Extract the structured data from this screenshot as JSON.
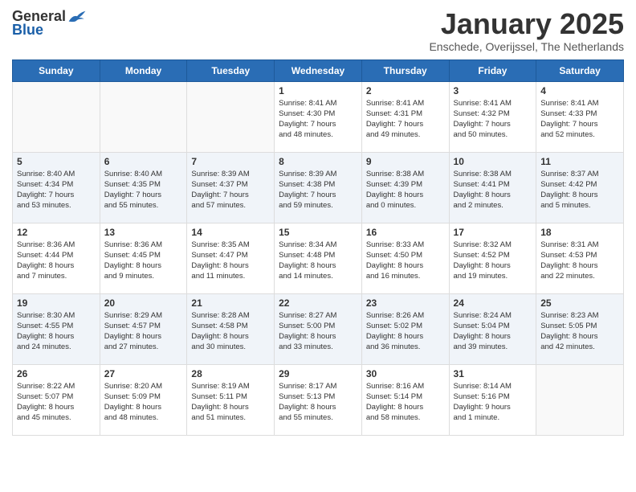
{
  "logo": {
    "general": "General",
    "blue": "Blue"
  },
  "title": "January 2025",
  "location": "Enschede, Overijssel, The Netherlands",
  "days_header": [
    "Sunday",
    "Monday",
    "Tuesday",
    "Wednesday",
    "Thursday",
    "Friday",
    "Saturday"
  ],
  "weeks": [
    {
      "shaded": false,
      "days": [
        {
          "num": "",
          "info": ""
        },
        {
          "num": "",
          "info": ""
        },
        {
          "num": "",
          "info": ""
        },
        {
          "num": "1",
          "info": "Sunrise: 8:41 AM\nSunset: 4:30 PM\nDaylight: 7 hours\nand 48 minutes."
        },
        {
          "num": "2",
          "info": "Sunrise: 8:41 AM\nSunset: 4:31 PM\nDaylight: 7 hours\nand 49 minutes."
        },
        {
          "num": "3",
          "info": "Sunrise: 8:41 AM\nSunset: 4:32 PM\nDaylight: 7 hours\nand 50 minutes."
        },
        {
          "num": "4",
          "info": "Sunrise: 8:41 AM\nSunset: 4:33 PM\nDaylight: 7 hours\nand 52 minutes."
        }
      ]
    },
    {
      "shaded": true,
      "days": [
        {
          "num": "5",
          "info": "Sunrise: 8:40 AM\nSunset: 4:34 PM\nDaylight: 7 hours\nand 53 minutes."
        },
        {
          "num": "6",
          "info": "Sunrise: 8:40 AM\nSunset: 4:35 PM\nDaylight: 7 hours\nand 55 minutes."
        },
        {
          "num": "7",
          "info": "Sunrise: 8:39 AM\nSunset: 4:37 PM\nDaylight: 7 hours\nand 57 minutes."
        },
        {
          "num": "8",
          "info": "Sunrise: 8:39 AM\nSunset: 4:38 PM\nDaylight: 7 hours\nand 59 minutes."
        },
        {
          "num": "9",
          "info": "Sunrise: 8:38 AM\nSunset: 4:39 PM\nDaylight: 8 hours\nand 0 minutes."
        },
        {
          "num": "10",
          "info": "Sunrise: 8:38 AM\nSunset: 4:41 PM\nDaylight: 8 hours\nand 2 minutes."
        },
        {
          "num": "11",
          "info": "Sunrise: 8:37 AM\nSunset: 4:42 PM\nDaylight: 8 hours\nand 5 minutes."
        }
      ]
    },
    {
      "shaded": false,
      "days": [
        {
          "num": "12",
          "info": "Sunrise: 8:36 AM\nSunset: 4:44 PM\nDaylight: 8 hours\nand 7 minutes."
        },
        {
          "num": "13",
          "info": "Sunrise: 8:36 AM\nSunset: 4:45 PM\nDaylight: 8 hours\nand 9 minutes."
        },
        {
          "num": "14",
          "info": "Sunrise: 8:35 AM\nSunset: 4:47 PM\nDaylight: 8 hours\nand 11 minutes."
        },
        {
          "num": "15",
          "info": "Sunrise: 8:34 AM\nSunset: 4:48 PM\nDaylight: 8 hours\nand 14 minutes."
        },
        {
          "num": "16",
          "info": "Sunrise: 8:33 AM\nSunset: 4:50 PM\nDaylight: 8 hours\nand 16 minutes."
        },
        {
          "num": "17",
          "info": "Sunrise: 8:32 AM\nSunset: 4:52 PM\nDaylight: 8 hours\nand 19 minutes."
        },
        {
          "num": "18",
          "info": "Sunrise: 8:31 AM\nSunset: 4:53 PM\nDaylight: 8 hours\nand 22 minutes."
        }
      ]
    },
    {
      "shaded": true,
      "days": [
        {
          "num": "19",
          "info": "Sunrise: 8:30 AM\nSunset: 4:55 PM\nDaylight: 8 hours\nand 24 minutes."
        },
        {
          "num": "20",
          "info": "Sunrise: 8:29 AM\nSunset: 4:57 PM\nDaylight: 8 hours\nand 27 minutes."
        },
        {
          "num": "21",
          "info": "Sunrise: 8:28 AM\nSunset: 4:58 PM\nDaylight: 8 hours\nand 30 minutes."
        },
        {
          "num": "22",
          "info": "Sunrise: 8:27 AM\nSunset: 5:00 PM\nDaylight: 8 hours\nand 33 minutes."
        },
        {
          "num": "23",
          "info": "Sunrise: 8:26 AM\nSunset: 5:02 PM\nDaylight: 8 hours\nand 36 minutes."
        },
        {
          "num": "24",
          "info": "Sunrise: 8:24 AM\nSunset: 5:04 PM\nDaylight: 8 hours\nand 39 minutes."
        },
        {
          "num": "25",
          "info": "Sunrise: 8:23 AM\nSunset: 5:05 PM\nDaylight: 8 hours\nand 42 minutes."
        }
      ]
    },
    {
      "shaded": false,
      "days": [
        {
          "num": "26",
          "info": "Sunrise: 8:22 AM\nSunset: 5:07 PM\nDaylight: 8 hours\nand 45 minutes."
        },
        {
          "num": "27",
          "info": "Sunrise: 8:20 AM\nSunset: 5:09 PM\nDaylight: 8 hours\nand 48 minutes."
        },
        {
          "num": "28",
          "info": "Sunrise: 8:19 AM\nSunset: 5:11 PM\nDaylight: 8 hours\nand 51 minutes."
        },
        {
          "num": "29",
          "info": "Sunrise: 8:17 AM\nSunset: 5:13 PM\nDaylight: 8 hours\nand 55 minutes."
        },
        {
          "num": "30",
          "info": "Sunrise: 8:16 AM\nSunset: 5:14 PM\nDaylight: 8 hours\nand 58 minutes."
        },
        {
          "num": "31",
          "info": "Sunrise: 8:14 AM\nSunset: 5:16 PM\nDaylight: 9 hours\nand 1 minute."
        },
        {
          "num": "",
          "info": ""
        }
      ]
    }
  ]
}
